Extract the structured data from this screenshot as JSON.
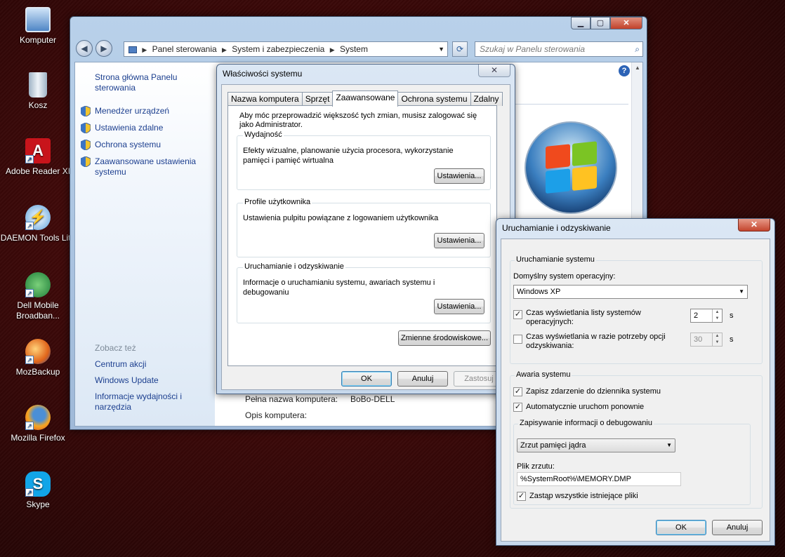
{
  "desktop": {
    "icons": [
      {
        "label": "Komputer",
        "icon": "computer-icon"
      },
      {
        "label": "Kosz",
        "icon": "recycle-bin-icon"
      },
      {
        "label": "Adobe Reader XI",
        "icon": "adobe-reader-icon"
      },
      {
        "label": "DAEMON Tools Lite",
        "icon": "daemon-tools-icon"
      },
      {
        "label": "Dell Mobile",
        "label2": "Broadban...",
        "icon": "dell-broadband-icon"
      },
      {
        "label": "MozBackup",
        "icon": "mozbackup-icon"
      },
      {
        "label": "Mozilla Firefox",
        "icon": "firefox-icon"
      },
      {
        "label": "Skype",
        "icon": "skype-icon"
      }
    ]
  },
  "explorer": {
    "breadcrumb": [
      "Panel sterowania",
      "System i zabezpieczenia",
      "System"
    ],
    "search_placeholder": "Szukaj w Panelu sterowania",
    "left_pane": {
      "home_link": "Strona główna Panelu sterowania",
      "tasks": [
        "Menedżer urządzeń",
        "Ustawienia zdalne",
        "Ochrona systemu",
        "Zaawansowane ustawienia systemu"
      ],
      "see_also_heading": "Zobacz też",
      "see_also": [
        "Centrum akcji",
        "Windows Update",
        "Informacje wydajności i narzędzia"
      ]
    },
    "computer_name_label": "Pełna nazwa komputera:",
    "computer_name_value": "BoBo-DELL",
    "computer_desc_label": "Opis komputera:"
  },
  "system_properties": {
    "title": "Właściwości systemu",
    "tabs": [
      "Nazwa komputera",
      "Sprzęt",
      "Zaawansowane",
      "Ochrona systemu",
      "Zdalny"
    ],
    "active_tab": "Zaawansowane",
    "admin_note": "Aby móc przeprowadzić większość tych zmian, musisz zalogować się jako Administrator.",
    "groups": [
      {
        "label": "Wydajność",
        "text": "Efekty wizualne, planowanie użycia procesora, wykorzystanie pamięci i pamięć wirtualna",
        "button": "Ustawienia..."
      },
      {
        "label": "Profile użytkownika",
        "text": "Ustawienia pulpitu powiązane z logowaniem użytkownika",
        "button": "Ustawienia..."
      },
      {
        "label": "Uruchamianie i odzyskiwanie",
        "text": "Informacje o uruchamianiu systemu, awariach systemu i debugowaniu",
        "button": "Ustawienia..."
      }
    ],
    "env_button": "Zmienne środowiskowe...",
    "ok": "OK",
    "cancel": "Anuluj",
    "apply": "Zastosuj"
  },
  "recovery": {
    "title": "Uruchamianie i odzyskiwanie",
    "startup_group": "Uruchamianie systemu",
    "default_os_label": "Domyślny system operacyjny:",
    "default_os_value": "Windows XP",
    "show_list_label": "Czas wyświetlania listy systemów operacyjnych:",
    "show_list_checked": true,
    "show_list_value": "2",
    "show_recovery_label": "Czas wyświetlania w razie potrzeby opcji odzyskiwania:",
    "show_recovery_checked": false,
    "show_recovery_value": "30",
    "unit": "s",
    "failure_group": "Awaria systemu",
    "write_event_label": "Zapisz zdarzenie do dziennika systemu",
    "auto_restart_label": "Automatycznie uruchom ponownie",
    "debug_group": "Zapisywanie informacji o debugowaniu",
    "dump_type": "Zrzut pamięci jądra",
    "dump_file_label": "Plik zrzutu:",
    "dump_file_value": "%SystemRoot%\\MEMORY.DMP",
    "overwrite_label": "Zastąp wszystkie istniejące pliki",
    "ok": "OK",
    "cancel": "Anuluj"
  }
}
